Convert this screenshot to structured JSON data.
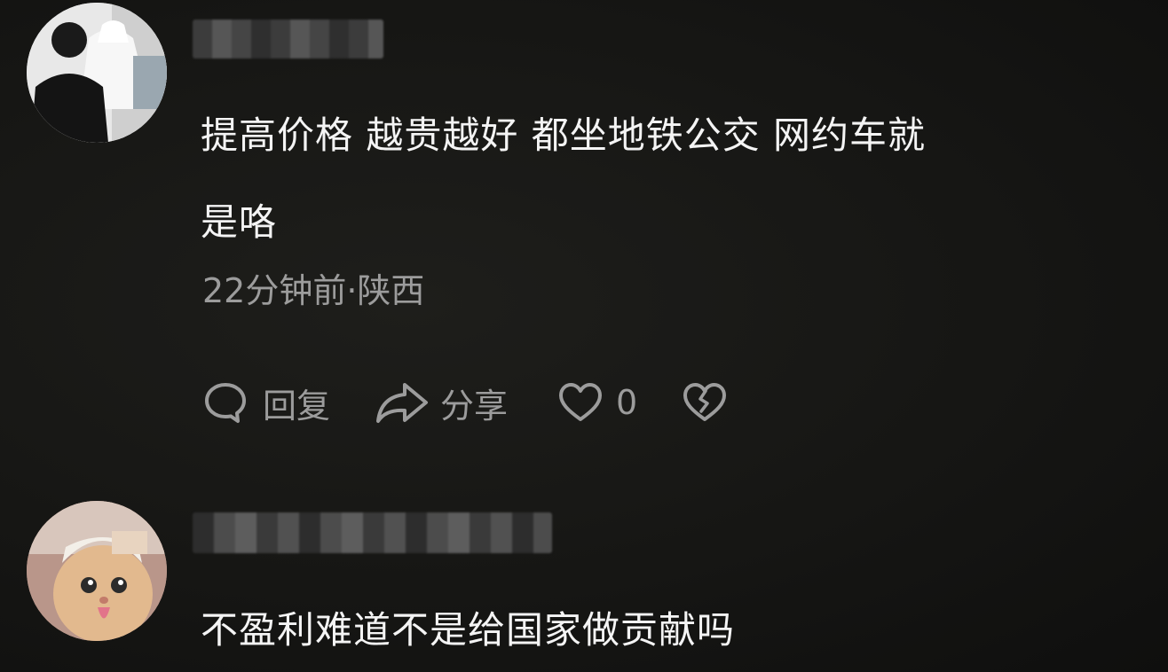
{
  "comments": [
    {
      "avatar": "avatar-man-wedding-dress-photo",
      "text_lines": [
        "提高价格 越贵越好 都坐地铁公交 网约车就",
        "是咯"
      ],
      "meta": "22分钟前·陕西",
      "actions": {
        "reply_label": "回复",
        "share_label": "分享",
        "like_count": "0"
      }
    },
    {
      "avatar": "avatar-cat-photo",
      "text_lines": [
        "不盈利难道不是给国家做贡献吗"
      ]
    }
  ],
  "colors": {
    "background": "#141414",
    "text": "#f4f4f4",
    "secondary_text": "#9c9c9c"
  },
  "icons": [
    "comment-bubble-icon",
    "share-arrow-icon",
    "heart-icon",
    "broken-heart-icon"
  ]
}
